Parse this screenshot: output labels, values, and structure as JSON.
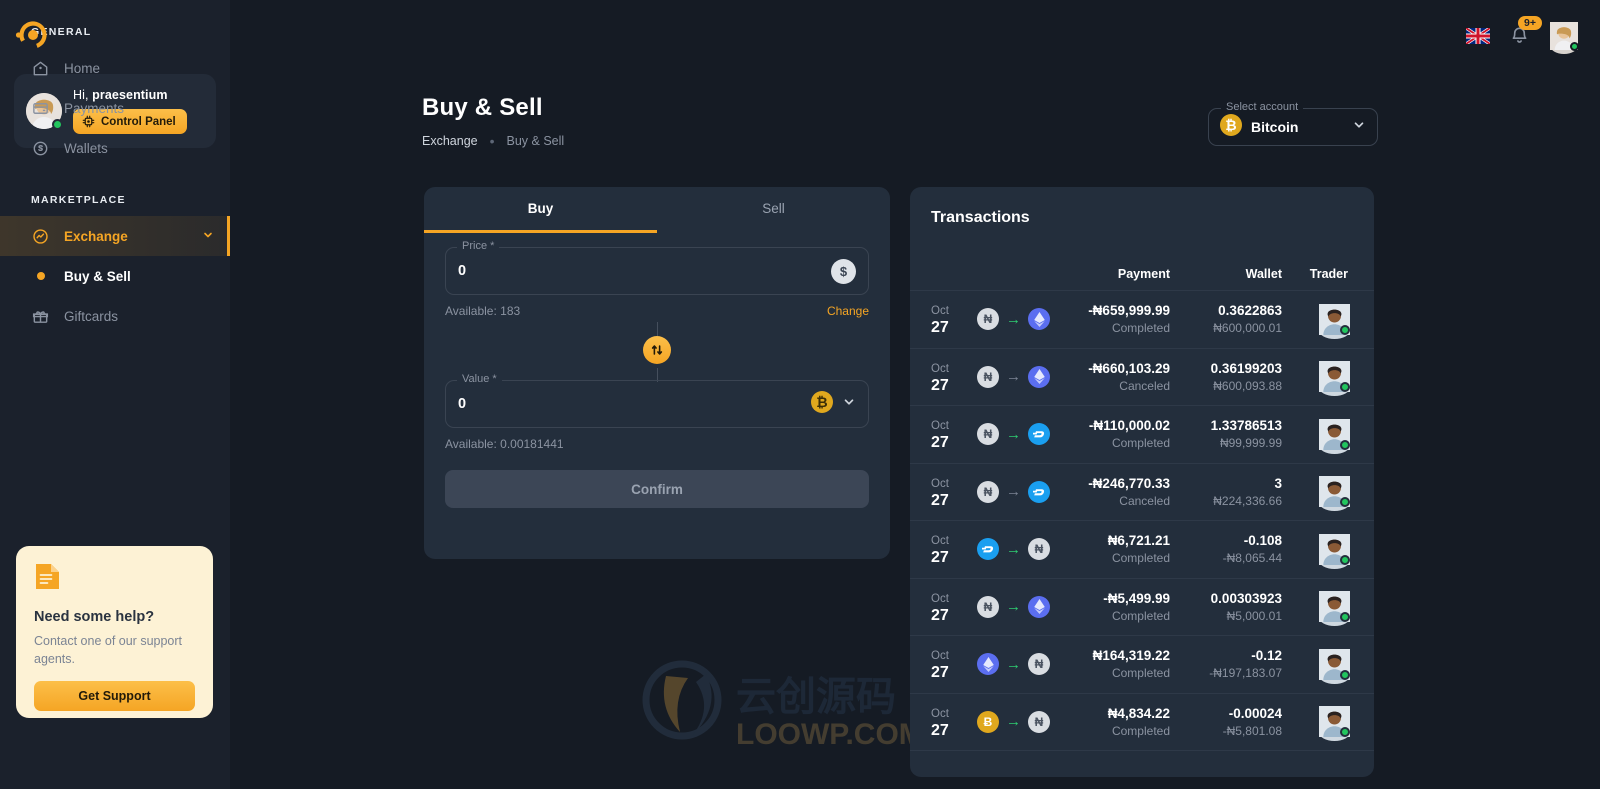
{
  "brand": {
    "logo_icon": "circular-c-logo",
    "accent": "#f5a524"
  },
  "sidebar": {
    "profile": {
      "greeting_prefix": "Hi,",
      "username": "praesentium",
      "control_panel_label": "Control Panel",
      "control_panel_icon": "chip-icon",
      "avatar": "user-avatar",
      "status": "online"
    },
    "sections": [
      {
        "label": "GENERAL",
        "items": [
          {
            "label": "Home",
            "icon": "home-icon"
          },
          {
            "label": "Payments",
            "icon": "card-icon"
          },
          {
            "label": "Wallets",
            "icon": "coin-icon"
          }
        ]
      },
      {
        "label": "MARKETPLACE",
        "items": [
          {
            "label": "Exchange",
            "icon": "exchange-icon",
            "active": true,
            "chevron": "chevron-down-icon"
          },
          {
            "label": "Buy & Sell",
            "icon": "bullet-dot",
            "sub": true,
            "current": true
          },
          {
            "label": "Giftcards",
            "icon": "gift-icon"
          }
        ]
      }
    ],
    "help": {
      "icon": "document-icon",
      "title": "Need some help?",
      "text": "Contact one of our support agents.",
      "button": "Get Support"
    }
  },
  "topbar": {
    "language_icon": "uk-flag-icon",
    "notifications_icon": "bell-icon",
    "notifications_count": "9+",
    "avatar": "user-avatar",
    "status": "online"
  },
  "page": {
    "title": "Buy & Sell",
    "breadcrumb": {
      "parent": "Exchange",
      "separator": "•",
      "current": "Buy & Sell"
    },
    "select_account": {
      "label": "Select account",
      "value": "Bitcoin",
      "icon": "bitcoin-icon",
      "chevron": "chevron-down-icon"
    }
  },
  "exchange": {
    "tabs": [
      {
        "label": "Buy",
        "active": true
      },
      {
        "label": "Sell",
        "active": false
      }
    ],
    "price_field": {
      "label": "Price *",
      "value": "0",
      "currency_icon": "dollar-icon",
      "available": "Available: 183",
      "change_link": "Change"
    },
    "swap_icon": "swap-vertical-icon",
    "value_field": {
      "label": "Value *",
      "value": "0",
      "currency_icon": "bitcoin-icon",
      "chevron": "chevron-down-icon",
      "available": "Available: 0.00181441"
    },
    "confirm_label": "Confirm"
  },
  "transactions": {
    "title": "Transactions",
    "columns": [
      "",
      "",
      "Payment",
      "Wallet",
      "Trader"
    ],
    "rows": [
      {
        "month": "Oct",
        "day": "27",
        "from": "NGN",
        "to": "ETH",
        "arrow": "ok",
        "payment": "-₦659,999.99",
        "status": "Completed",
        "wallet": "0.3622863",
        "wallet_sub": "₦600,000.01"
      },
      {
        "month": "Oct",
        "day": "27",
        "from": "NGN",
        "to": "ETH",
        "arrow": "no",
        "payment": "-₦660,103.29",
        "status": "Canceled",
        "wallet": "0.36199203",
        "wallet_sub": "₦600,093.88"
      },
      {
        "month": "Oct",
        "day": "27",
        "from": "NGN",
        "to": "DASH",
        "arrow": "ok",
        "payment": "-₦110,000.02",
        "status": "Completed",
        "wallet": "1.33786513",
        "wallet_sub": "₦99,999.99"
      },
      {
        "month": "Oct",
        "day": "27",
        "from": "NGN",
        "to": "DASH",
        "arrow": "no",
        "payment": "-₦246,770.33",
        "status": "Canceled",
        "wallet": "3",
        "wallet_sub": "₦224,336.66"
      },
      {
        "month": "Oct",
        "day": "27",
        "from": "DASH",
        "to": "NGN",
        "arrow": "ok",
        "payment": "₦6,721.21",
        "status": "Completed",
        "wallet": "-0.108",
        "wallet_sub": "-₦8,065.44"
      },
      {
        "month": "Oct",
        "day": "27",
        "from": "NGN",
        "to": "ETH",
        "arrow": "ok",
        "payment": "-₦5,499.99",
        "status": "Completed",
        "wallet": "0.00303923",
        "wallet_sub": "₦5,000.01"
      },
      {
        "month": "Oct",
        "day": "27",
        "from": "ETH",
        "to": "NGN",
        "arrow": "ok",
        "payment": "₦164,319.22",
        "status": "Completed",
        "wallet": "-0.12",
        "wallet_sub": "-₦197,183.07"
      },
      {
        "month": "Oct",
        "day": "27",
        "from": "BTC",
        "to": "NGN",
        "arrow": "ok",
        "payment": "₦4,834.22",
        "status": "Completed",
        "wallet": "-0.00024",
        "wallet_sub": "-₦5,801.08"
      }
    ]
  },
  "watermark": {
    "cn": "云创源码",
    "en": "LOOWP.COM"
  }
}
